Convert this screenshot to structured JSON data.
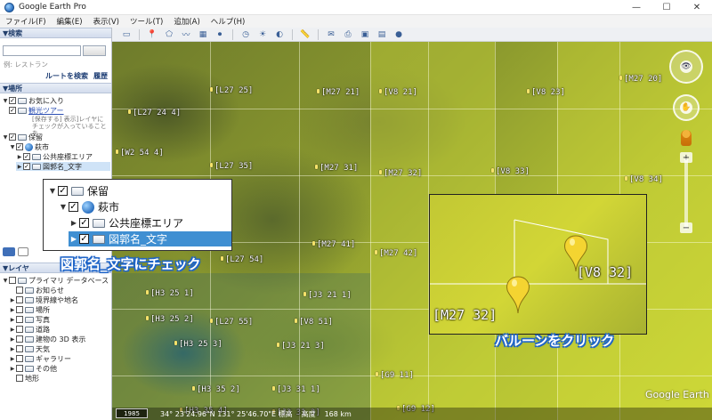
{
  "window": {
    "title": "Google Earth Pro",
    "min": "—",
    "max": "☐",
    "close": "✕"
  },
  "menu": [
    "ファイル(F)",
    "編集(E)",
    "表示(V)",
    "ツール(T)",
    "追加(A)",
    "ヘルプ(H)"
  ],
  "search": {
    "header": "▼検索",
    "placeholder": "",
    "hint": "例: レストラン",
    "route_link": "ルートを検索",
    "history_link": "履歴"
  },
  "places": {
    "header": "▼場所",
    "favorites": "お気に入り",
    "tour": "観光ツアー",
    "tour_note_1": "[保存する] 表示]レイヤに",
    "tour_note_2": "チェックが入っていることを",
    "temporary": "保留",
    "city": "萩市",
    "public_area": "公共座標エリア",
    "map_names": "図郭名_文字"
  },
  "layers": {
    "header": "▼レイヤ",
    "primary": "プライマリ データベース",
    "items": [
      "お知らせ",
      "境界線や地名",
      "場所",
      "写真",
      "道路",
      "建物の 3D 表示",
      "天気",
      "ギャラリー",
      "その他",
      "地形"
    ]
  },
  "inset_tree": {
    "temporary": "保留",
    "city": "萩市",
    "public_area": "公共座標エリア",
    "map_names": "図郭名_文字"
  },
  "callouts": {
    "check": "図郭名_文字にチェック",
    "balloon": "バルーンをクリック"
  },
  "map_labels": [
    "[L27 25]",
    "[M27 21]",
    "[V8 21]",
    "[V8 23]",
    "[M27 20]",
    "[L27 24 4]",
    "[L27 35]",
    "[M27 31]",
    "[M27 32]",
    "[V8 33]",
    "[V8 34]",
    "[W2 54 4]",
    "[M27 41]",
    "[M27 42]",
    "[H3 25 1]",
    "[J3 21 1]",
    "[H3 25 2]",
    "[L27 55]",
    "[V8 51]",
    "[H3 25 3]",
    "[J3 21 3]",
    "[H3 35 2]",
    "[J3 31 1]",
    "[G9 11]",
    "[H3 35 4]",
    "[J3 31 3]",
    "[G9 12]",
    "[L27 54]"
  ],
  "inset_labels": {
    "v8_32": "[V8 32]",
    "m27_32": "[M27 32]"
  },
  "status": {
    "year": "1985",
    "coords": "34° 23'24.96\"N 131° 25'46.70\"E 標高",
    "altitude": "高度",
    "altitude_val": "168 km"
  },
  "brand": "Google Earth",
  "colors": {
    "accent": "#1e64c8",
    "selection": "#3f8fd2"
  }
}
